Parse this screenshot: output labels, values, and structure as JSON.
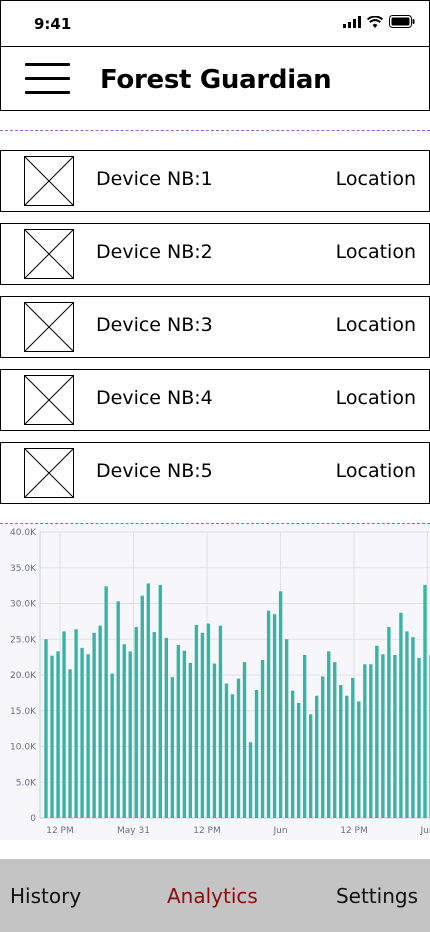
{
  "status_bar": {
    "time": "9:41",
    "icons": [
      "signal-icon",
      "wifi-icon",
      "battery-icon"
    ]
  },
  "header": {
    "title": "Forest Guardian",
    "menu_icon": "hamburger-menu-icon"
  },
  "devices": [
    {
      "name": "Device NB:1",
      "location": "Location",
      "thumbnail_icon": "image-placeholder-icon"
    },
    {
      "name": "Device NB:2",
      "location": "Location",
      "thumbnail_icon": "image-placeholder-icon"
    },
    {
      "name": "Device NB:3",
      "location": "Location",
      "thumbnail_icon": "image-placeholder-icon"
    },
    {
      "name": "Device NB:4",
      "location": "Location",
      "thumbnail_icon": "image-placeholder-icon"
    },
    {
      "name": "Device NB:5",
      "location": "Location",
      "thumbnail_icon": "image-placeholder-icon"
    }
  ],
  "chart_data": {
    "type": "bar",
    "ylim": [
      0,
      40000
    ],
    "y_ticks": [
      "0",
      "5.0K",
      "10.0K",
      "15.0K",
      "20.0K",
      "25.0K",
      "30.0K",
      "35.0K",
      "40.0K"
    ],
    "x_ticks": [
      "12 PM",
      "May 31",
      "12 PM",
      "Jun",
      "12 PM",
      "Jun"
    ],
    "grid": true,
    "bar_color": "#3bb3a4",
    "values": [
      25000,
      22700,
      23300,
      26100,
      20800,
      26400,
      23800,
      22900,
      25900,
      26900,
      32400,
      20200,
      30300,
      24300,
      23300,
      26700,
      31100,
      32800,
      26000,
      32600,
      25200,
      19700,
      24200,
      23400,
      21700,
      27000,
      25900,
      27200,
      21600,
      26900,
      18800,
      17300,
      19500,
      21800,
      10600,
      17900,
      22100,
      29000,
      28500,
      31700,
      25000,
      17800,
      16100,
      22800,
      14500,
      17100,
      19800,
      23300,
      21800,
      18600,
      17100,
      19600,
      16300,
      21500,
      21500,
      24100,
      22900,
      26700,
      22800,
      28700,
      26100,
      25300,
      22400,
      32600,
      22800
    ]
  },
  "bottom_nav": {
    "items": [
      {
        "label": "History",
        "active": false
      },
      {
        "label": "Analytics",
        "active": true
      },
      {
        "label": "Settings",
        "active": false
      }
    ],
    "active_color": "#8b0c0c"
  }
}
